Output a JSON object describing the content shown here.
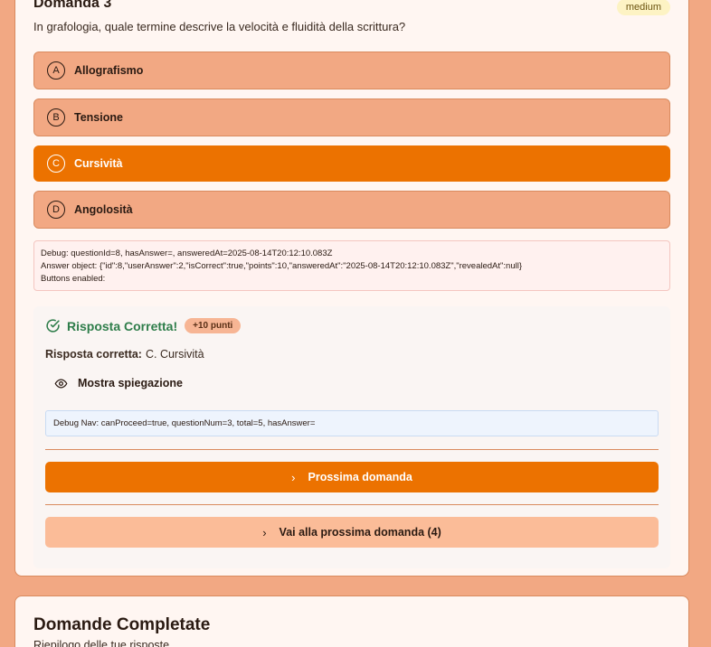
{
  "question": {
    "title": "Domanda 3",
    "difficulty": "medium",
    "text": "In grafologia, quale termine descrive la velocità e fluidità della scrittura?"
  },
  "options": [
    {
      "letter": "A",
      "label": "Allografismo",
      "selected": false
    },
    {
      "letter": "B",
      "label": "Tensione",
      "selected": false
    },
    {
      "letter": "C",
      "label": "Cursività",
      "selected": true
    },
    {
      "letter": "D",
      "label": "Angolosità",
      "selected": false
    }
  ],
  "debug": {
    "line1": "Debug: questionId=8, hasAnswer=, answeredAt=2025-08-14T20:12:10.083Z",
    "line2": "Answer object: {\"id\":8,\"userAnswer\":2,\"isCorrect\":true,\"points\":10,\"answeredAt\":\"2025-08-14T20:12:10.083Z\",\"revealedAt\":null}",
    "line3": "Buttons enabled:"
  },
  "result": {
    "title": "Risposta Corretta!",
    "points_badge": "+10 punti",
    "correct_label": "Risposta corretta:",
    "correct_value": "C. Cursività",
    "explain_label": "Mostra spiegazione",
    "debug_nav": "Debug Nav: canProceed=true, questionNum=3, total=5, hasAnswer=",
    "next_label": "Prossima domanda",
    "skip_label": "Vai alla prossima domanda (4)",
    "success_color": "#2e7d4a"
  },
  "summary": {
    "title": "Domande Completate",
    "subtitle": "Riepilogo delle tue risposte"
  },
  "colors": {
    "background": "#f2a883",
    "accent": "#ec7200",
    "option_bg": "#f2a883",
    "skip_bg": "#fbbc98"
  },
  "icons": {
    "success": "check-circle-icon",
    "explain": "eye-icon",
    "next": "chevron-right-icon"
  }
}
